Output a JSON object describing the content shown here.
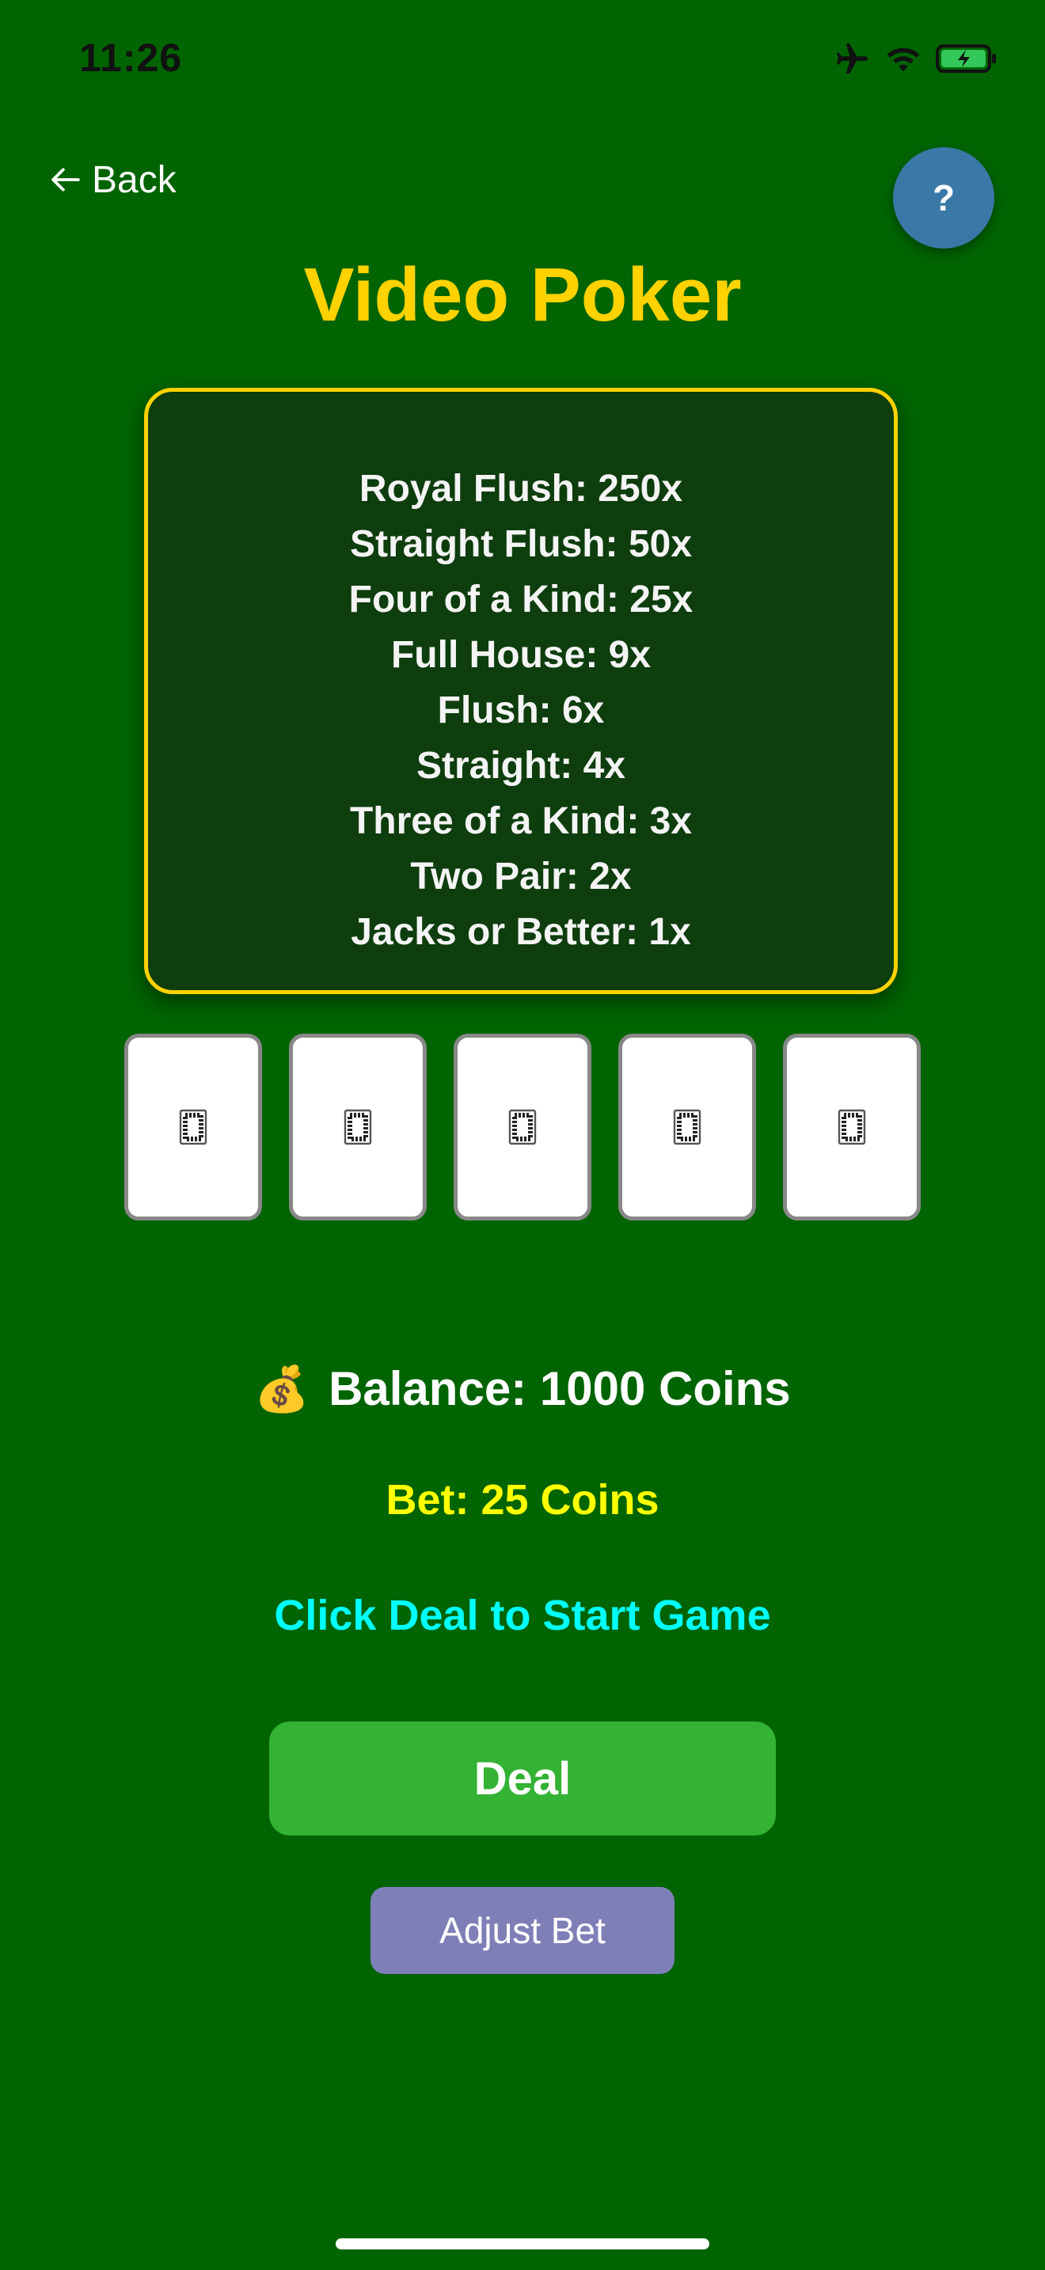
{
  "status_bar": {
    "time": "11:26",
    "icons": [
      "airplane-icon",
      "wifi-icon",
      "battery-charging-icon"
    ],
    "battery_color": "#34c759"
  },
  "nav": {
    "back_label": "Back",
    "back_icon": "arrow-left-icon",
    "help_label": "?"
  },
  "title": "Video Poker",
  "paytable": [
    "Royal Flush: 250x",
    "Straight Flush: 50x",
    "Four of a Kind: 25x",
    "Full House: 9x",
    "Flush: 6x",
    "Straight: 4x",
    "Three of a Kind: 3x",
    "Two Pair: 2x",
    "Jacks or Better: 1x"
  ],
  "cards": [
    {
      "face": "card-back-icon"
    },
    {
      "face": "card-back-icon"
    },
    {
      "face": "card-back-icon"
    },
    {
      "face": "card-back-icon"
    },
    {
      "face": "card-back-icon"
    }
  ],
  "balance": {
    "icon": "💰",
    "text": "Balance: 1000 Coins"
  },
  "bet_text": "Bet: 25 Coins",
  "message": "Click Deal to Start Game",
  "buttons": {
    "deal": "Deal",
    "adjust_bet": "Adjust Bet"
  },
  "colors": {
    "background": "#006400",
    "title": "#ffd200",
    "bet": "#ffff00",
    "message": "#00ffff",
    "deal_button": "#33b233",
    "adjust_button": "#7f7fb8",
    "help_button": "#3a78a8"
  }
}
